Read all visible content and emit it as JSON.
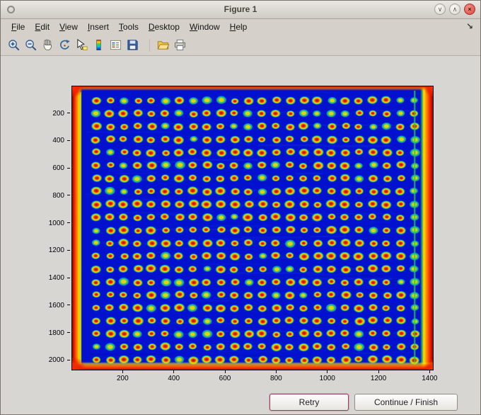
{
  "window": {
    "title": "Figure 1",
    "controls": [
      {
        "name": "shade-button",
        "glyph": "∨"
      },
      {
        "name": "maximize-button",
        "glyph": "∧"
      },
      {
        "name": "close-button",
        "glyph": "×"
      }
    ]
  },
  "menubar": {
    "items": [
      {
        "label": "File"
      },
      {
        "label": "Edit"
      },
      {
        "label": "View"
      },
      {
        "label": "Insert"
      },
      {
        "label": "Tools"
      },
      {
        "label": "Desktop"
      },
      {
        "label": "Window"
      },
      {
        "label": "Help"
      }
    ],
    "dock_glyph": "↘"
  },
  "toolbar": {
    "group1": [
      "zoom-in",
      "zoom-out",
      "pan",
      "rotate-3d",
      "data-cursor",
      "colorbar",
      "legend",
      "save"
    ],
    "group2": [
      "open-folder",
      "print"
    ]
  },
  "figure": {
    "axes": {
      "x_ticks": [
        200,
        400,
        600,
        800,
        1000,
        1200,
        1400
      ],
      "y_ticks": [
        200,
        400,
        600,
        800,
        1000,
        1200,
        1400,
        1600,
        1800,
        2000
      ],
      "x_max": 1410,
      "y_max": 2065
    },
    "image": {
      "description": "microarray plate scan, jet colormap",
      "rows": 21,
      "cols": 24,
      "background": "#0111cd",
      "spot_core": "#a80e00",
      "spot_mid": "#ff8c00",
      "spot_ring": "#ffe100",
      "spot_outer": "#46c832",
      "spot_halo": "#00b4d8",
      "edge_red": "#f02000",
      "edge_orange": "#ff9000",
      "edge_yellow": "#ffe100",
      "edge_green": "#22cc44"
    }
  },
  "actions": {
    "retry": "Retry",
    "continue": "Continue / Finish"
  }
}
